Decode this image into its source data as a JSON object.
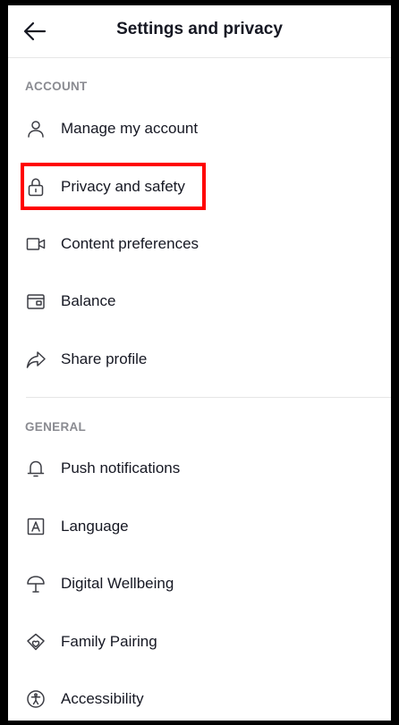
{
  "header": {
    "title": "Settings and privacy",
    "back_icon": "arrow-left-icon"
  },
  "sections": {
    "account": {
      "label": "ACCOUNT",
      "items": [
        {
          "label": "Manage my account",
          "icon": "person-icon"
        },
        {
          "label": "Privacy and safety",
          "icon": "lock-icon"
        },
        {
          "label": "Content preferences",
          "icon": "video-camera-icon"
        },
        {
          "label": "Balance",
          "icon": "wallet-icon"
        },
        {
          "label": "Share profile",
          "icon": "share-arrow-icon"
        }
      ]
    },
    "general": {
      "label": "GENERAL",
      "items": [
        {
          "label": "Push notifications",
          "icon": "bell-icon"
        },
        {
          "label": "Language",
          "icon": "language-a-icon"
        },
        {
          "label": "Digital Wellbeing",
          "icon": "umbrella-icon"
        },
        {
          "label": "Family Pairing",
          "icon": "family-house-icon"
        },
        {
          "label": "Accessibility",
          "icon": "accessibility-icon"
        }
      ]
    }
  },
  "colors": {
    "highlight": "#ff0000",
    "text_primary": "#161823",
    "text_secondary": "#8a8b91",
    "divider": "#e6e6e6"
  }
}
